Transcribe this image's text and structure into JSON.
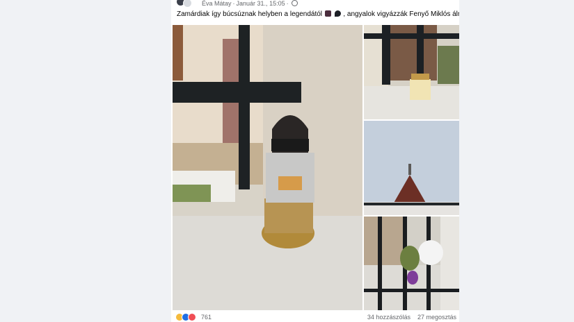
{
  "post": {
    "author": "Éva Mátay",
    "separator": "·",
    "date": "Január 31., 15:05",
    "separator2": "·",
    "text_before": "Zamárdiak így búcsúznak helyben a legendától",
    "text_after": ", angyalok vigyázzák Fenyő Miklós álmát."
  },
  "gallery": {
    "photos": [
      {
        "icon": "grave-lantern-photo"
      },
      {
        "icon": "candle-photo"
      },
      {
        "icon": "roof-photo"
      },
      {
        "icon": "flowers-photo"
      }
    ]
  },
  "footer": {
    "reaction_count": "761",
    "comments": "34 hozzászólás",
    "shares": "27 megosztás"
  },
  "colors": {
    "background": "#f0f2f5",
    "card": "#ffffff",
    "muted_text": "#65676b",
    "text": "#050505"
  }
}
